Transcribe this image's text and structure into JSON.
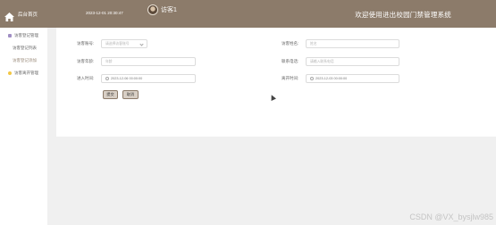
{
  "header": {
    "brand": "后台首页",
    "datetime": "2023-12-01 20:30:47",
    "username": "访客1",
    "site_title": "欢迎使用进出校园门禁管理系统"
  },
  "sidebar": {
    "groups": [
      {
        "label": "访客登记管理",
        "color": "#a08ec4",
        "items": [
          "访客登记列表",
          "访客登记添加"
        ]
      },
      {
        "label": "访客离开管理",
        "color": "#f2c744",
        "items": []
      }
    ]
  },
  "form": {
    "fields": [
      {
        "label": "访客账号:",
        "value": "请选择访客账号",
        "type": "select"
      },
      {
        "label": "访客姓名:",
        "value": "姓名",
        "type": "text"
      },
      {
        "label": "访客年龄:",
        "value": "年龄",
        "type": "text"
      },
      {
        "label": "联系电话:",
        "value": "请输入联系电话",
        "type": "text"
      },
      {
        "label": "进入时间:",
        "value": "2023-12-06 00:00:00",
        "type": "datetime"
      },
      {
        "label": "离开时间:",
        "value": "2023-12-03 00:00:00",
        "type": "datetime"
      }
    ],
    "submit_label": "提交",
    "cancel_label": "取消"
  },
  "watermark": "CSDN @VX_bysjlw985",
  "colors": {
    "header": "#8c7b6a",
    "button": "#d8cfc5"
  }
}
